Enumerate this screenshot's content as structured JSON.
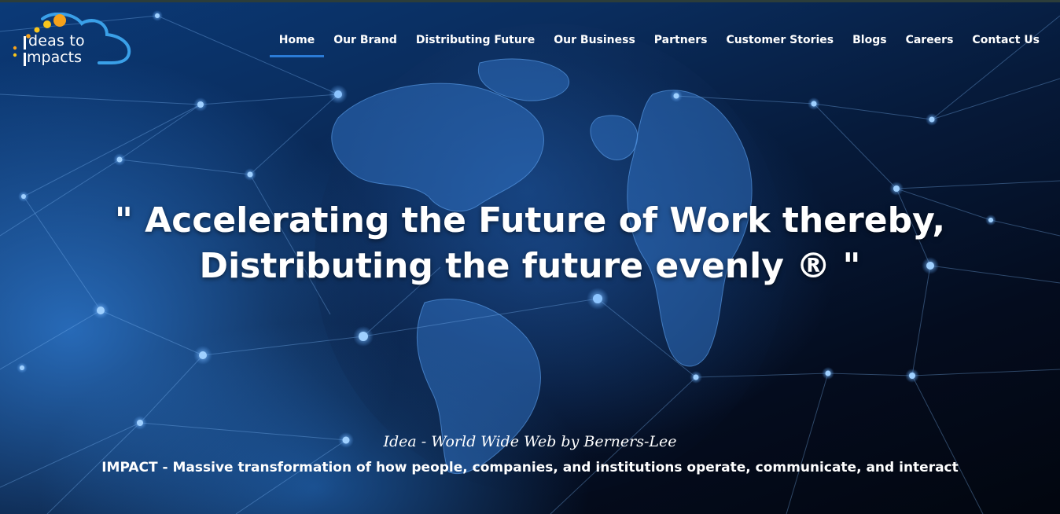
{
  "logo": {
    "line1": "deas to",
    "line2": "mpacts"
  },
  "nav": {
    "items": [
      {
        "label": "Home",
        "active": true
      },
      {
        "label": "Our Brand"
      },
      {
        "label": "Distributing Future"
      },
      {
        "label": "Our Business"
      },
      {
        "label": "Partners"
      },
      {
        "label": "Customer Stories"
      },
      {
        "label": "Blogs"
      },
      {
        "label": "Careers"
      },
      {
        "label": "Contact Us"
      }
    ]
  },
  "hero": {
    "headline_line1": "\" Accelerating the Future of Work thereby,",
    "headline_line2": "Distributing the future evenly ® \"",
    "idea_text": "Idea - World Wide Web by Berners-Lee",
    "impact_text": "IMPACT - Massive transformation of how people, companies, and institutions operate, communicate, and interact"
  },
  "colors": {
    "accent": "#2b7bd6",
    "logo_cloud": "#3aa0e8",
    "logo_dot_orange": "#f6a21b",
    "logo_dot_yellow": "#f8c51c",
    "background_dark": "#030916",
    "background_blue": "#0b3a78"
  }
}
